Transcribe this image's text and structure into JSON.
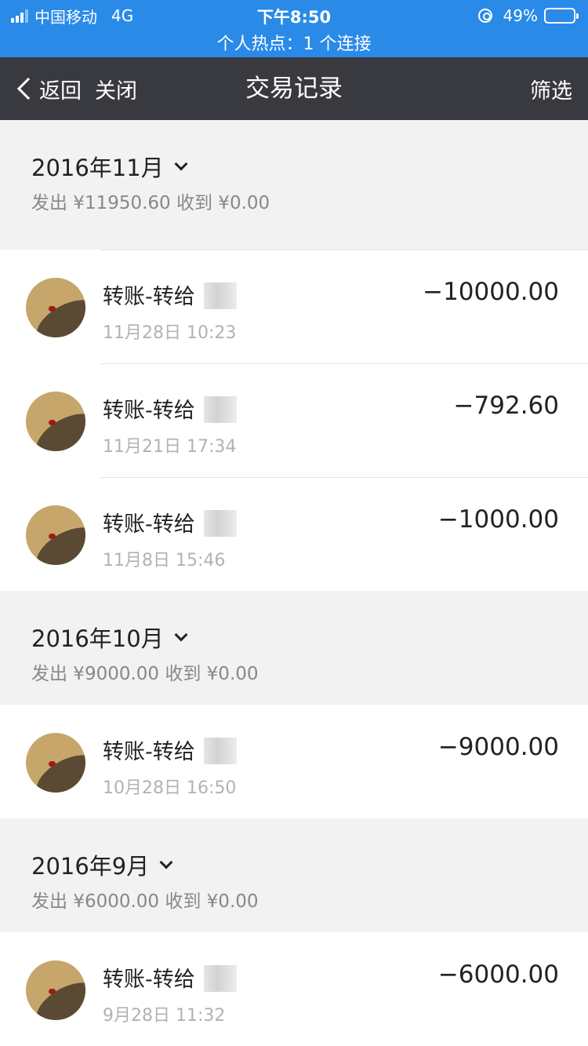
{
  "status_bar": {
    "carrier": "中国移动",
    "network": "4G",
    "time": "下午8:50",
    "battery": "49%",
    "battery_level": 0.49,
    "hotspot": "个人热点：1 个连接"
  },
  "nav": {
    "back": "返回",
    "close": "关闭",
    "title": "交易记录",
    "filter": "筛选"
  },
  "months": [
    {
      "title": "2016年11月",
      "summary": "发出 ¥11950.60 收到 ¥0.00",
      "transactions": [
        {
          "title": "转账-转给",
          "time": "11月28日 10:23",
          "amount": "−10000.00"
        },
        {
          "title": "转账-转给",
          "time": "11月21日 17:34",
          "amount": "−792.60"
        },
        {
          "title": "转账-转给",
          "time": "11月8日 15:46",
          "amount": "−1000.00"
        }
      ]
    },
    {
      "title": "2016年10月",
      "summary": "发出 ¥9000.00 收到 ¥0.00",
      "transactions": [
        {
          "title": "转账-转给",
          "time": "10月28日 16:50",
          "amount": "−9000.00"
        }
      ]
    },
    {
      "title": "2016年9月",
      "summary": "发出 ¥6000.00 收到 ¥0.00",
      "transactions": [
        {
          "title": "转账-转给",
          "time": "9月28日 11:32",
          "amount": "−6000.00"
        }
      ]
    }
  ]
}
